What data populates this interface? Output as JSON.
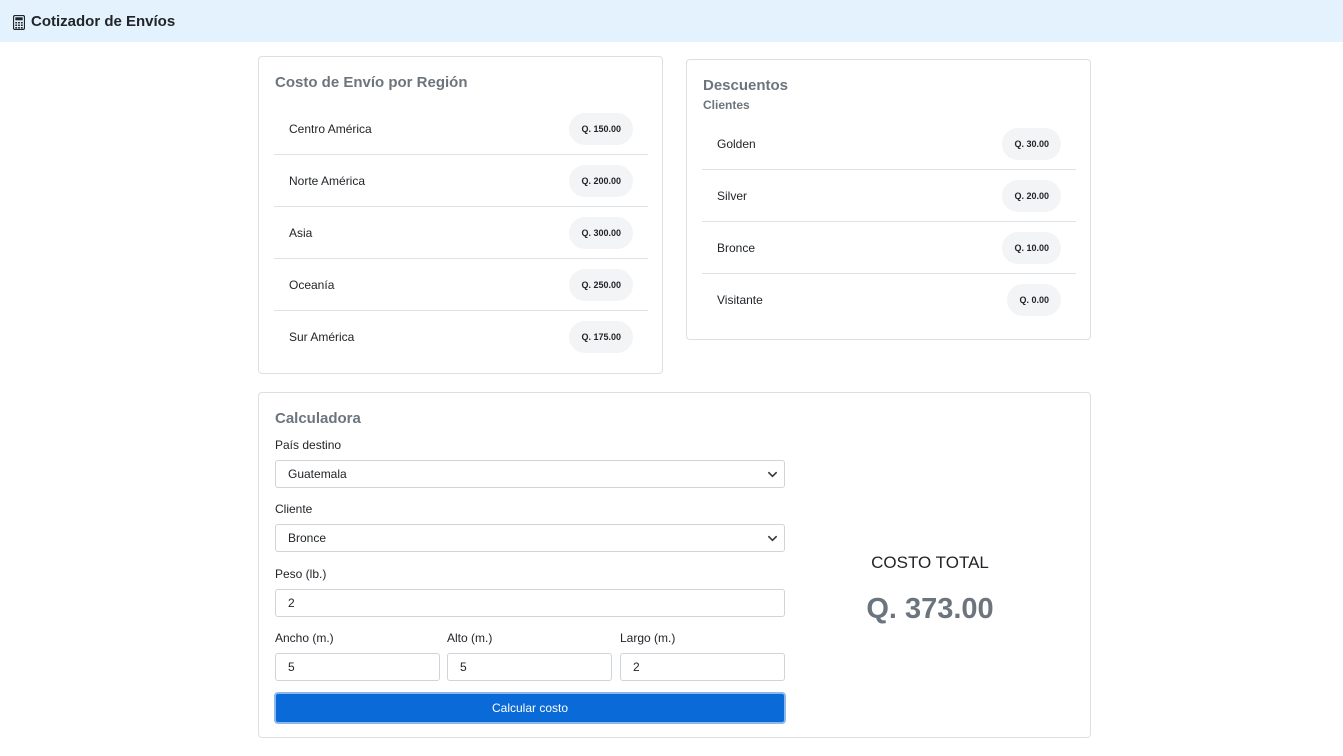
{
  "navbar": {
    "title": "Cotizador de Envíos",
    "icon": "calculator-icon"
  },
  "regions": {
    "title": "Costo de Envío por Región",
    "items": [
      {
        "label": "Centro América",
        "cost": "Q. 150.00"
      },
      {
        "label": "Norte América",
        "cost": "Q. 200.00"
      },
      {
        "label": "Asia",
        "cost": "Q. 300.00"
      },
      {
        "label": "Oceanía",
        "cost": "Q. 250.00"
      },
      {
        "label": "Sur América",
        "cost": "Q. 175.00"
      }
    ]
  },
  "discounts": {
    "title": "Descuentos",
    "subtitle": "Clientes",
    "items": [
      {
        "label": "Golden",
        "amount": "Q. 30.00"
      },
      {
        "label": "Silver",
        "amount": "Q. 20.00"
      },
      {
        "label": "Bronce",
        "amount": "Q. 10.00"
      },
      {
        "label": "Visitante",
        "amount": "Q. 0.00"
      }
    ]
  },
  "calculator": {
    "title": "Calculadora",
    "country_label": "País destino",
    "country_value": "Guatemala",
    "client_label": "Cliente",
    "client_value": "Bronce",
    "weight_label": "Peso (lb.)",
    "weight_value": "2",
    "width_label": "Ancho (m.)",
    "width_value": "5",
    "height_label": "Alto (m.)",
    "height_value": "5",
    "length_label": "Largo (m.)",
    "length_value": "2",
    "button_label": "Calcular costo",
    "total_label": "COSTO TOTAL",
    "total_value": "Q. 373.00"
  },
  "colors": {
    "navbar_bg": "#e3f2fd",
    "primary": "#0a6ad8",
    "muted": "#6c757d"
  }
}
